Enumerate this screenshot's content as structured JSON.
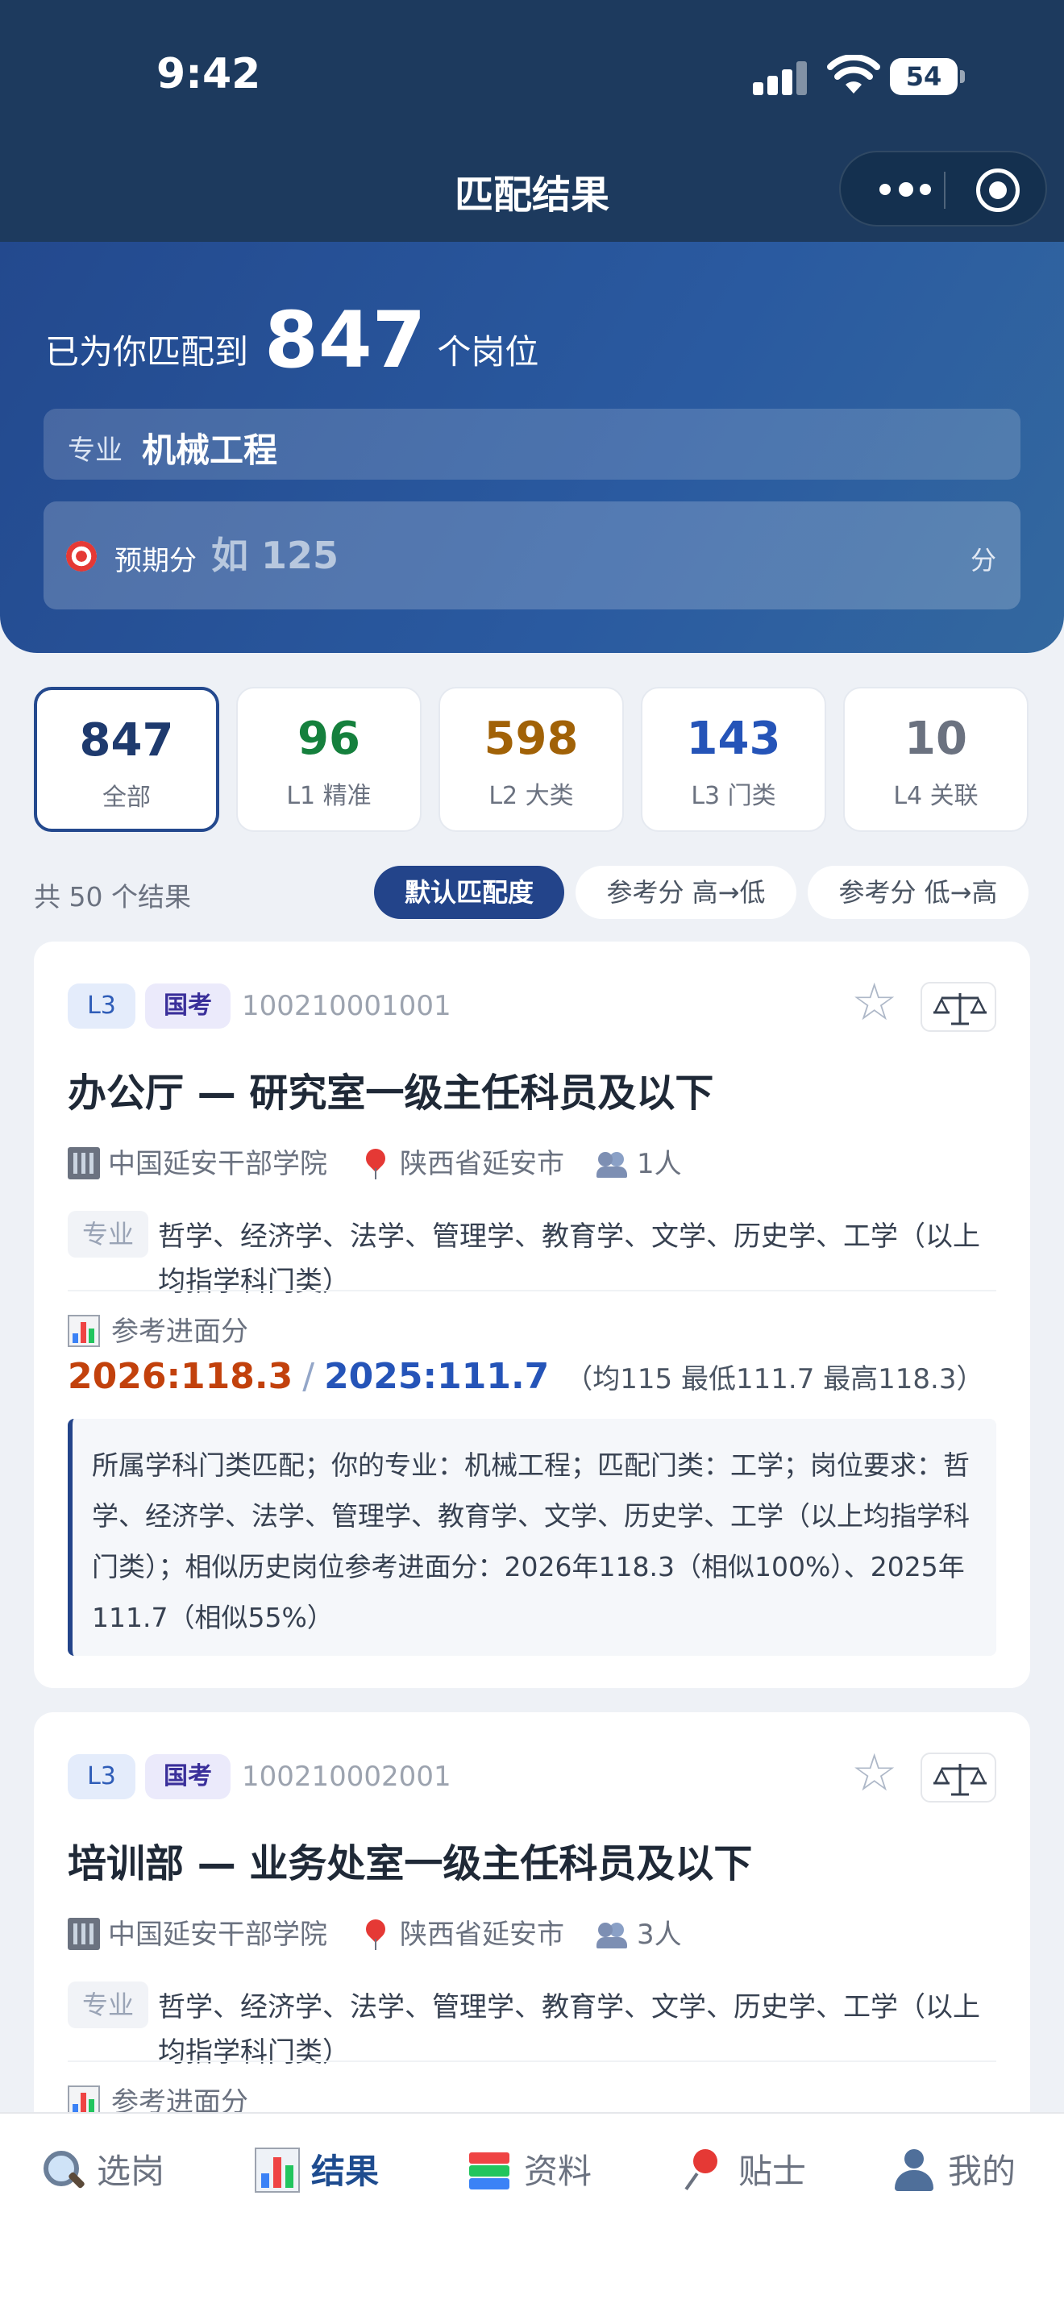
{
  "status": {
    "time": "9:42",
    "battery": "54"
  },
  "nav": {
    "title": "匹配结果"
  },
  "hero": {
    "prefix": "已为你匹配到",
    "count": "847",
    "suffix": "个岗位",
    "major_label": "专业",
    "major_value": "机械工程",
    "score_label": "预期分",
    "score_placeholder": "如 125",
    "score_value": "",
    "score_unit": "分"
  },
  "levels": [
    {
      "num": "847",
      "label": "全部",
      "color": "#1e3a6e"
    },
    {
      "num": "96",
      "label": "L1 精准",
      "color": "#15803d"
    },
    {
      "num": "598",
      "label": "L2 大类",
      "color": "#a16207"
    },
    {
      "num": "143",
      "label": "L3 门类",
      "color": "#2554b8"
    },
    {
      "num": "10",
      "label": "L4 关联",
      "color": "#6b7280"
    }
  ],
  "sort": {
    "result_count": "共 50 个结果",
    "options": [
      "默认匹配度",
      "参考分 高→低",
      "参考分 低→高"
    ],
    "active": "默认匹配度"
  },
  "cards": [
    {
      "level": "L3",
      "exam": "国考",
      "code": "100210001001",
      "title": "办公厅 — 研究室一级主任科员及以下",
      "org": "中国延安干部学院",
      "location": "陕西省延安市",
      "headcount": "1人",
      "major_tag": "专业",
      "requirement": "哲学、经济学、法学、管理学、教育学、文学、历史学、工学（以上均指学科门类）",
      "ref_title": "参考进面分",
      "score_2026": "2026:118.3",
      "score_2025": "2025:111.7",
      "score_stats": "（均115 最低111.7 最高118.3）",
      "reason": "所属学科门类匹配；你的专业：机械工程；匹配门类：工学；岗位要求：哲学、经济学、法学、管理学、教育学、文学、历史学、工学（以上均指学科门类）；相似历史岗位参考进面分：2026年118.3（相似100%）、2025年111.7（相似55%）"
    },
    {
      "level": "L3",
      "exam": "国考",
      "code": "100210002001",
      "title": "培训部 — 业务处室一级主任科员及以下",
      "org": "中国延安干部学院",
      "location": "陕西省延安市",
      "headcount": "3人",
      "major_tag": "专业",
      "requirement": "哲学、经济学、法学、管理学、教育学、文学、历史学、工学（以上均指学科门类）",
      "ref_title": "参考进面分"
    }
  ],
  "bottom_nav": [
    {
      "label": "选岗",
      "icon": "search-icon"
    },
    {
      "label": "结果",
      "icon": "bar-chart-icon",
      "active": true
    },
    {
      "label": "资料",
      "icon": "books-icon"
    },
    {
      "label": "贴士",
      "icon": "pushpin-icon"
    },
    {
      "label": "我的",
      "icon": "user-icon"
    }
  ],
  "colors": {
    "header_bg": "#1d3a5e",
    "accent": "#23448a",
    "score_2026": "#c2410c",
    "score_2025": "#2554b8"
  }
}
